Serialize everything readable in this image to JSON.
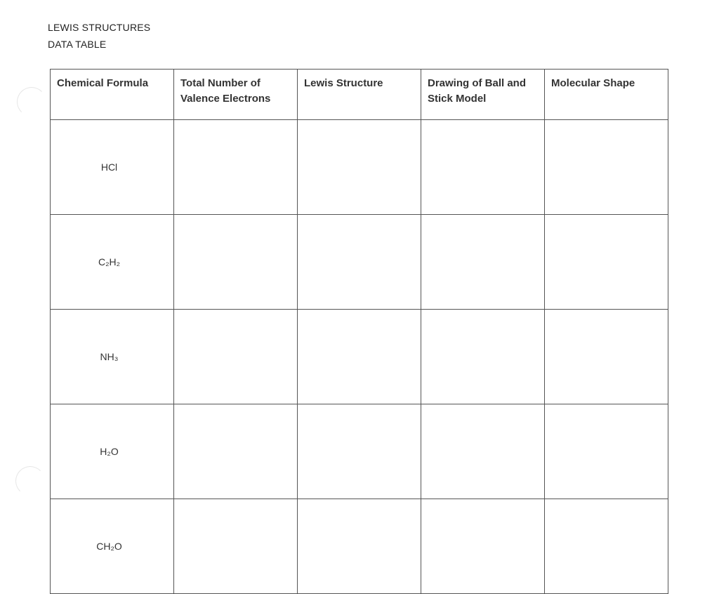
{
  "document": {
    "title": "LEWIS STRUCTURES",
    "subtitle": "DATA TABLE"
  },
  "table": {
    "headers": [
      "Chemical Formula",
      "Total Number of Valence Electrons",
      "Lewis Structure",
      "Drawing of Ball and Stick Model",
      "Molecular Shape"
    ],
    "rows": [
      {
        "formula": "HCl"
      },
      {
        "formula": "C₂H₂"
      },
      {
        "formula": "NH₃"
      },
      {
        "formula": "H₂O"
      },
      {
        "formula": "CH₂O"
      }
    ]
  }
}
